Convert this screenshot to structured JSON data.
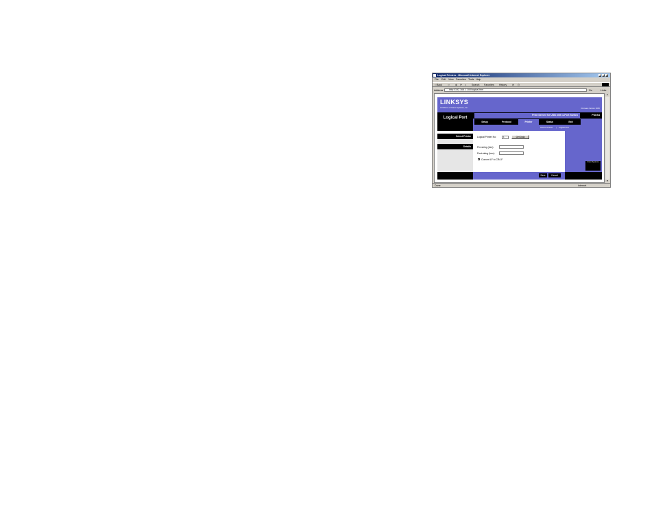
{
  "window": {
    "title": "Logical Printers - Microsoft Internet Explorer",
    "minimize": "_",
    "maximize": "□",
    "close": "×"
  },
  "menu": [
    "File",
    "Edit",
    "View",
    "Favorites",
    "Tools",
    "Help"
  ],
  "toolbar": {
    "back": "⇦Back",
    "forward": "⇨",
    "stop": "⊗",
    "refresh": "⟳",
    "home": "⌂",
    "search": "Search",
    "favorites": "Favorites",
    "history": "History",
    "mail": "✉",
    "print": "⎙"
  },
  "address_bar": {
    "label": "Address",
    "url": "http://192.168.1.100/logical.htm",
    "go": "Go",
    "links": "Links"
  },
  "page": {
    "brand": "LINKSYS",
    "brand_sub": "A Division of Cisco Systems, Inc.",
    "firmware": "Firmware Version: 6050",
    "section_title": "Logical Port",
    "product_name": "Print Server for USB with 4-Port Switch",
    "model": "PSUS4",
    "tabs": [
      {
        "label": "Setup",
        "active": false
      },
      {
        "label": "Protocol",
        "active": false
      },
      {
        "label": "Printer",
        "active": true
      },
      {
        "label": "Status",
        "active": false
      },
      {
        "label": "Exit",
        "active": false
      }
    ],
    "subtabs": {
      "internet_printer": "Internet Printer",
      "separator": "|",
      "logical_port": "Logical Port"
    },
    "select_printer_header": "Select Printer",
    "details_header": "Details",
    "logical_printer_label": "Logical Printer No:",
    "logical_printer_value": "1",
    "get_data_button": "Get Data",
    "pre_string_label": "Pre-string (hex):",
    "pre_string_value": "",
    "post_string_label": "Post-string (hex):",
    "post_string_value": "",
    "convert_label": "Convert LF to CR/LF",
    "convert_checked": false,
    "save_button": "Save",
    "cancel_button": "Cancel",
    "cisco_logo": "Cisco Systems"
  },
  "status_bar": {
    "left": "Done",
    "zone": "Internet"
  },
  "colors": {
    "linksys_blue": "#6666cc",
    "titlebar_start": "#0a246a",
    "titlebar_end": "#a6caf0"
  }
}
